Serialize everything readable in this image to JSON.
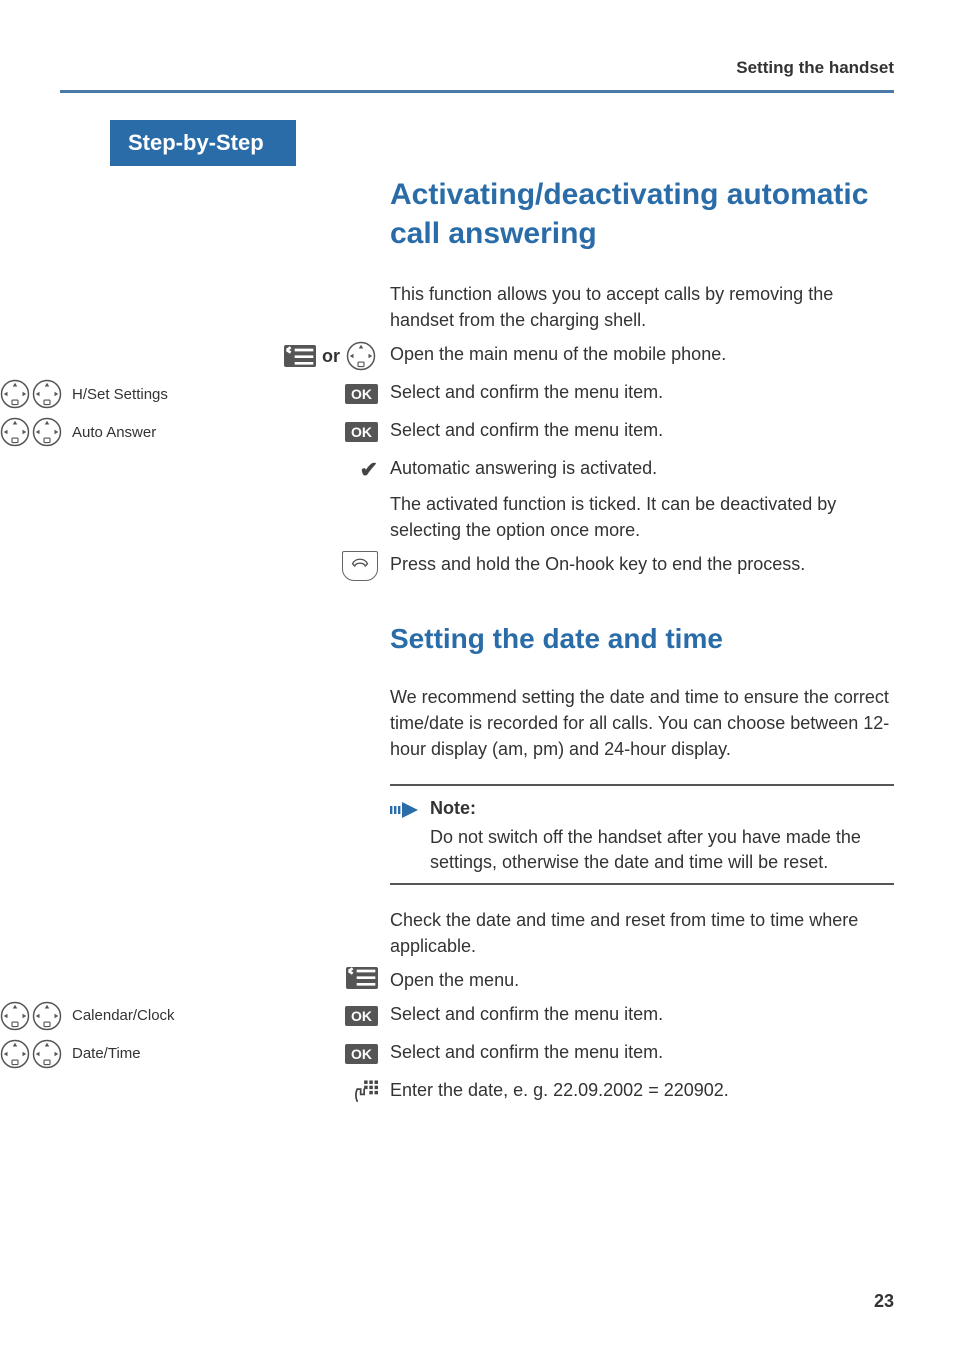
{
  "header": {
    "section": "Setting the handset"
  },
  "sidebar": {
    "banner": "Step-by-Step"
  },
  "section1": {
    "title": "Activating/deactivating automatic call answering",
    "intro": "This function allows you to accept calls by removing the handset from the charging shell.",
    "or_word": "or",
    "step_open": "Open the main menu of the mobile phone.",
    "item_hset": "H/Set Settings",
    "step_hset": "Select and confirm the menu item.",
    "item_auto": "Auto Answer",
    "step_auto": "Select and confirm the menu item.",
    "step_check": "Automatic answering is activated.",
    "step_ticked": "The activated function is ticked. It can be deactivated by selecting the option once more.",
    "step_end": "Press and hold the On-hook key to end the process.",
    "ok": "OK"
  },
  "section2": {
    "title": "Setting the date and time",
    "intro": "We recommend setting the date and time to ensure the correct time/date is recorded for all calls. You can choose between 12-hour display (am, pm) and 24-hour display.",
    "note_title": "Note:",
    "note_body": "Do not switch off the handset after you have made the settings, otherwise the date and time will be reset.",
    "after_note": "Check the date and time and reset from time to time where applicable.",
    "step_open": "Open the menu.",
    "item_cal": "Calendar/Clock",
    "step_cal": "Select and confirm the menu item.",
    "item_dt": "Date/Time",
    "step_dt": "Select and confirm the menu item.",
    "step_enter": "Enter the date, e. g. 22.09.2002 = 220902.",
    "ok": "OK"
  },
  "footer": {
    "page": "23"
  }
}
